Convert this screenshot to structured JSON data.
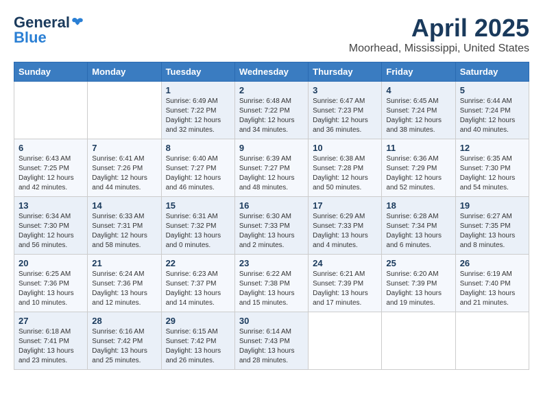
{
  "logo": {
    "general": "General",
    "blue": "Blue"
  },
  "header": {
    "title": "April 2025",
    "location": "Moorhead, Mississippi, United States"
  },
  "weekdays": [
    "Sunday",
    "Monday",
    "Tuesday",
    "Wednesday",
    "Thursday",
    "Friday",
    "Saturday"
  ],
  "weeks": [
    [
      {
        "day": "",
        "info": ""
      },
      {
        "day": "",
        "info": ""
      },
      {
        "day": "1",
        "info": "Sunrise: 6:49 AM\nSunset: 7:22 PM\nDaylight: 12 hours and 32 minutes."
      },
      {
        "day": "2",
        "info": "Sunrise: 6:48 AM\nSunset: 7:22 PM\nDaylight: 12 hours and 34 minutes."
      },
      {
        "day": "3",
        "info": "Sunrise: 6:47 AM\nSunset: 7:23 PM\nDaylight: 12 hours and 36 minutes."
      },
      {
        "day": "4",
        "info": "Sunrise: 6:45 AM\nSunset: 7:24 PM\nDaylight: 12 hours and 38 minutes."
      },
      {
        "day": "5",
        "info": "Sunrise: 6:44 AM\nSunset: 7:24 PM\nDaylight: 12 hours and 40 minutes."
      }
    ],
    [
      {
        "day": "6",
        "info": "Sunrise: 6:43 AM\nSunset: 7:25 PM\nDaylight: 12 hours and 42 minutes."
      },
      {
        "day": "7",
        "info": "Sunrise: 6:41 AM\nSunset: 7:26 PM\nDaylight: 12 hours and 44 minutes."
      },
      {
        "day": "8",
        "info": "Sunrise: 6:40 AM\nSunset: 7:27 PM\nDaylight: 12 hours and 46 minutes."
      },
      {
        "day": "9",
        "info": "Sunrise: 6:39 AM\nSunset: 7:27 PM\nDaylight: 12 hours and 48 minutes."
      },
      {
        "day": "10",
        "info": "Sunrise: 6:38 AM\nSunset: 7:28 PM\nDaylight: 12 hours and 50 minutes."
      },
      {
        "day": "11",
        "info": "Sunrise: 6:36 AM\nSunset: 7:29 PM\nDaylight: 12 hours and 52 minutes."
      },
      {
        "day": "12",
        "info": "Sunrise: 6:35 AM\nSunset: 7:30 PM\nDaylight: 12 hours and 54 minutes."
      }
    ],
    [
      {
        "day": "13",
        "info": "Sunrise: 6:34 AM\nSunset: 7:30 PM\nDaylight: 12 hours and 56 minutes."
      },
      {
        "day": "14",
        "info": "Sunrise: 6:33 AM\nSunset: 7:31 PM\nDaylight: 12 hours and 58 minutes."
      },
      {
        "day": "15",
        "info": "Sunrise: 6:31 AM\nSunset: 7:32 PM\nDaylight: 13 hours and 0 minutes."
      },
      {
        "day": "16",
        "info": "Sunrise: 6:30 AM\nSunset: 7:33 PM\nDaylight: 13 hours and 2 minutes."
      },
      {
        "day": "17",
        "info": "Sunrise: 6:29 AM\nSunset: 7:33 PM\nDaylight: 13 hours and 4 minutes."
      },
      {
        "day": "18",
        "info": "Sunrise: 6:28 AM\nSunset: 7:34 PM\nDaylight: 13 hours and 6 minutes."
      },
      {
        "day": "19",
        "info": "Sunrise: 6:27 AM\nSunset: 7:35 PM\nDaylight: 13 hours and 8 minutes."
      }
    ],
    [
      {
        "day": "20",
        "info": "Sunrise: 6:25 AM\nSunset: 7:36 PM\nDaylight: 13 hours and 10 minutes."
      },
      {
        "day": "21",
        "info": "Sunrise: 6:24 AM\nSunset: 7:36 PM\nDaylight: 13 hours and 12 minutes."
      },
      {
        "day": "22",
        "info": "Sunrise: 6:23 AM\nSunset: 7:37 PM\nDaylight: 13 hours and 14 minutes."
      },
      {
        "day": "23",
        "info": "Sunrise: 6:22 AM\nSunset: 7:38 PM\nDaylight: 13 hours and 15 minutes."
      },
      {
        "day": "24",
        "info": "Sunrise: 6:21 AM\nSunset: 7:39 PM\nDaylight: 13 hours and 17 minutes."
      },
      {
        "day": "25",
        "info": "Sunrise: 6:20 AM\nSunset: 7:39 PM\nDaylight: 13 hours and 19 minutes."
      },
      {
        "day": "26",
        "info": "Sunrise: 6:19 AM\nSunset: 7:40 PM\nDaylight: 13 hours and 21 minutes."
      }
    ],
    [
      {
        "day": "27",
        "info": "Sunrise: 6:18 AM\nSunset: 7:41 PM\nDaylight: 13 hours and 23 minutes."
      },
      {
        "day": "28",
        "info": "Sunrise: 6:16 AM\nSunset: 7:42 PM\nDaylight: 13 hours and 25 minutes."
      },
      {
        "day": "29",
        "info": "Sunrise: 6:15 AM\nSunset: 7:42 PM\nDaylight: 13 hours and 26 minutes."
      },
      {
        "day": "30",
        "info": "Sunrise: 6:14 AM\nSunset: 7:43 PM\nDaylight: 13 hours and 28 minutes."
      },
      {
        "day": "",
        "info": ""
      },
      {
        "day": "",
        "info": ""
      },
      {
        "day": "",
        "info": ""
      }
    ]
  ]
}
